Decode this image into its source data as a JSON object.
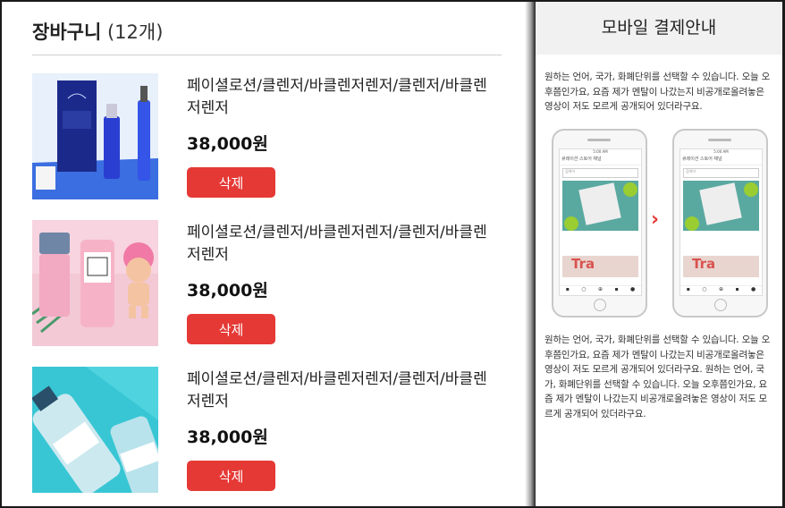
{
  "cart": {
    "title": "장바구니",
    "count": "(12개)",
    "items": [
      {
        "name": "페이셜로션/클렌저/바클렌저렌저/클렌저/바클렌저렌저",
        "price": "38,000원",
        "delete_label": "삭제"
      },
      {
        "name": "페이셜로션/클렌저/바클렌저렌저/클렌저/바클렌저렌저",
        "price": "38,000원",
        "delete_label": "삭제"
      },
      {
        "name": "페이셜로션/클렌저/바클렌저렌저/클렌저/바클렌저렌저",
        "price": "38,000원",
        "delete_label": "삭제"
      }
    ]
  },
  "guide": {
    "title": "모바일 결제안내",
    "text_top": "원하는 언어, 국가, 화폐단위를 선택할 수 있습니다. 오늘 오후쯤인가요, 요즘 제가 멘탈이 나갔는지 비공개로올려놓은 영상이 저도 모르게 공개되어 있더라구요.",
    "text_bottom": "원하는 언어, 국가, 화폐단위를 선택할 수 있습니다. 오늘 오후쯤인가요, 요즘 제가 멘탈이 나갔는지 비공개로올려놓은 영상이 저도 모르게 공개되어 있더라구요. 원하는 언어, 국가, 화폐단위를 선택할 수 있습니다. 오늘 오후쯤인가요, 요즘 제가 멘탈이 나갔는지 비공개로올려놓은 영상이 저도 모르게 공개되어 있더라구요.",
    "phone_status": "5:00 AM",
    "phone_tabs": "큐레이션  스토어  채널",
    "phone_search": "검색어",
    "phone_image_text": "Tra",
    "arrow_icon": "chevron-right-icon"
  },
  "colors": {
    "accent": "#e53935",
    "header_bg": "#f1f1f1"
  }
}
